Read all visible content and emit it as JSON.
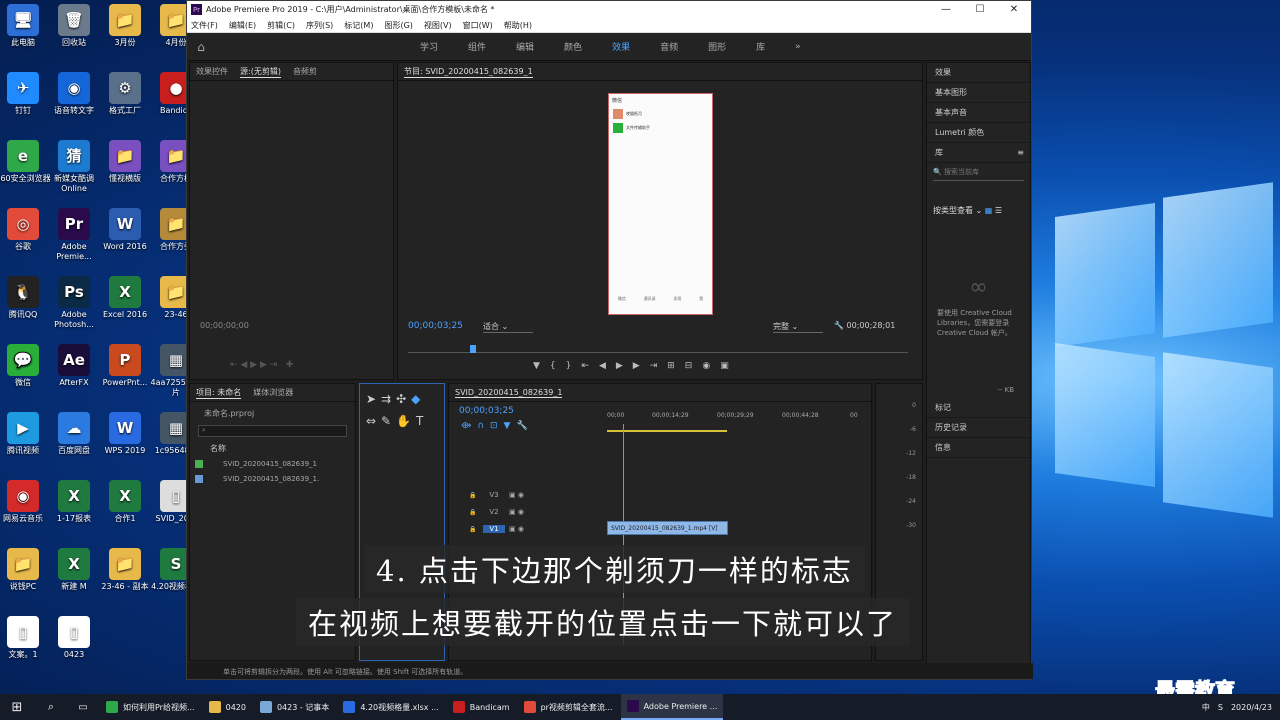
{
  "desktop": {
    "icons": [
      {
        "label": "此电脑",
        "glyph": "🖥",
        "color": "#2d6fd6"
      },
      {
        "label": "回收站",
        "glyph": "🗑",
        "color": "#6a7a8a"
      },
      {
        "label": "3月份",
        "glyph": "📁",
        "color": "#e7b84a"
      },
      {
        "label": "4月份",
        "glyph": "📁",
        "color": "#e7b84a"
      },
      {
        "label": "钉钉",
        "glyph": "✈",
        "color": "#1f8bff"
      },
      {
        "label": "语音转文字",
        "glyph": "◉",
        "color": "#1566d8"
      },
      {
        "label": "格式工厂",
        "glyph": "⚙",
        "color": "#5a6f8a"
      },
      {
        "label": "Bandica",
        "glyph": "●",
        "color": "#c81e1e"
      },
      {
        "label": "360安全浏览器",
        "glyph": "e",
        "color": "#2fa84a"
      },
      {
        "label": "新媒女酷调Online",
        "glyph": "猜",
        "color": "#1c7bd0"
      },
      {
        "label": "懂视横版",
        "glyph": "📁",
        "color": "#7a4fc0"
      },
      {
        "label": "合作方模",
        "glyph": "📁",
        "color": "#7a4fc0"
      },
      {
        "label": "谷歌",
        "glyph": "◎",
        "color": "#e24a3a"
      },
      {
        "label": "Adobe Premie...",
        "glyph": "Pr",
        "color": "#2a0a4a"
      },
      {
        "label": "Word 2016",
        "glyph": "W",
        "color": "#2b5cb0"
      },
      {
        "label": "合作方委",
        "glyph": "📁",
        "color": "#b58a3a"
      },
      {
        "label": "腾讯QQ",
        "glyph": "🐧",
        "color": "#222"
      },
      {
        "label": "Adobe Photosh...",
        "glyph": "Ps",
        "color": "#0b2a45"
      },
      {
        "label": "Excel 2016",
        "glyph": "X",
        "color": "#1e7a3e"
      },
      {
        "label": "23-46",
        "glyph": "📁",
        "color": "#e7b84a"
      },
      {
        "label": "微信",
        "glyph": "💬",
        "color": "#2aae3a"
      },
      {
        "label": "AfterFX",
        "glyph": "Ae",
        "color": "#1a0d3a"
      },
      {
        "label": "PowerPnt...",
        "glyph": "P",
        "color": "#c94a1e"
      },
      {
        "label": "4aa7255...图片",
        "glyph": "▦",
        "color": "#445566"
      },
      {
        "label": "腾讯视频",
        "glyph": "▶",
        "color": "#1e9be0"
      },
      {
        "label": "百度网盘",
        "glyph": "☁",
        "color": "#2a7ae0"
      },
      {
        "label": "WPS 2019",
        "glyph": "W",
        "color": "#2a6ae0"
      },
      {
        "label": "1c95648...",
        "glyph": "▦",
        "color": "#445566"
      },
      {
        "label": "网易云音乐",
        "glyph": "◉",
        "color": "#d42a2a"
      },
      {
        "label": "1-17报表",
        "glyph": "X",
        "color": "#1e7a3e"
      },
      {
        "label": "合作1",
        "glyph": "X",
        "color": "#1e7a3e"
      },
      {
        "label": "SVID_20...",
        "glyph": "▯",
        "color": "#dddddd"
      },
      {
        "label": "说钱PC",
        "glyph": "📁",
        "color": "#e7b84a"
      },
      {
        "label": "新建 M",
        "glyph": "X",
        "color": "#1e7a3e"
      },
      {
        "label": "23-46 - 副本",
        "glyph": "📁",
        "color": "#e7b84a"
      },
      {
        "label": "4.20视频格量",
        "glyph": "S",
        "color": "#1e7a3e"
      },
      {
        "label": "文案。1",
        "glyph": "▯",
        "color": "#ffffff"
      },
      {
        "label": "0423",
        "glyph": "▯",
        "color": "#ffffff"
      }
    ]
  },
  "app": {
    "title": "Adobe Premiere Pro 2019 - C:\\用户\\Administrator\\桌面\\合作方模板\\未命名 *",
    "menu": [
      "文件(F)",
      "编辑(E)",
      "剪辑(C)",
      "序列(S)",
      "标记(M)",
      "图形(G)",
      "视图(V)",
      "窗口(W)",
      "帮助(H)"
    ],
    "workspaces": [
      "学习",
      "组件",
      "编辑",
      "颜色",
      "效果",
      "音频",
      "图形",
      "库"
    ],
    "active_workspace": "效果"
  },
  "source": {
    "tabs": [
      "效果控件",
      "源:(无剪辑)",
      "音频剪"
    ],
    "timecode": "00;00;00;00"
  },
  "program": {
    "tab": "节目: SVID_20200415_082639_1",
    "timecode": "00;00;03;25",
    "fit": "适合",
    "quality": "完整",
    "duration": "00;00;28;01",
    "phone": {
      "header": "微信",
      "rows": [
        {
          "title": "夜猫纸月",
          "sub": "..."
        },
        {
          "title": "文件传输助手",
          "sub": "..."
        }
      ],
      "bottom": [
        "微信",
        "通讯录",
        "发现",
        "我"
      ]
    }
  },
  "project": {
    "tabs": [
      "项目: 未命名",
      "媒体浏览器"
    ],
    "file": "未命名.prproj",
    "column": "名称",
    "items": [
      {
        "name": "SVID_20200415_082639_1",
        "color": "#4caf50"
      },
      {
        "name": "SVID_20200415_082639_1.",
        "color": "#6a9ad6"
      }
    ]
  },
  "timeline": {
    "tab": "SVID_20200415_082639_1",
    "timecode": "00;00;03;25",
    "ruler": [
      "00;00",
      "00;00;14;29",
      "00;00;29;29",
      "00;00;44;28",
      "00"
    ],
    "tracks": [
      "V3",
      "V2",
      "V1"
    ],
    "clip": "SVID_20200415_082639_1.mp4 [V]",
    "meter_labels": [
      "0",
      "-6",
      "-12",
      "-18",
      "-24",
      "-30"
    ]
  },
  "right": {
    "top": [
      "效果",
      "基本图形",
      "基本声音",
      "Lumetri 颜色"
    ],
    "lib_title": "库",
    "search_placeholder": "搜索当前库",
    "view_label": "按类型查看",
    "cloud_text": "要使用 Creative Cloud Libraries，您需要登录 Creative Cloud 帐户。",
    "kb": "-- KB",
    "bottom": [
      "标记",
      "历史记录",
      "信息"
    ]
  },
  "status": "单击可将剪辑拆分为两段。使用 Alt 可忽略链接。使用 Shift 可选择所有轨道。",
  "subtitles": {
    "line1": "4. 点击下边那个剃须刀一样的标志",
    "line2": "在视频上想要截开的位置点击一下就可以了"
  },
  "watermark": "最需教育",
  "taskbar": {
    "items": [
      {
        "label": "如何利用Pr给视频...",
        "color": "#2fa84a"
      },
      {
        "label": "0420",
        "color": "#e7b84a"
      },
      {
        "label": "0423 - 记事本",
        "color": "#7aa8d6"
      },
      {
        "label": "4.20视频格量.xlsx ...",
        "color": "#2a6ae0"
      },
      {
        "label": "Bandicam",
        "color": "#c81e1e"
      },
      {
        "label": "pr视频剪辑全套流...",
        "color": "#e24a3a"
      },
      {
        "label": "Adobe Premiere ...",
        "color": "#2a0a4a"
      }
    ],
    "tray": [
      "中",
      "S"
    ],
    "date": "2020/4/23"
  }
}
